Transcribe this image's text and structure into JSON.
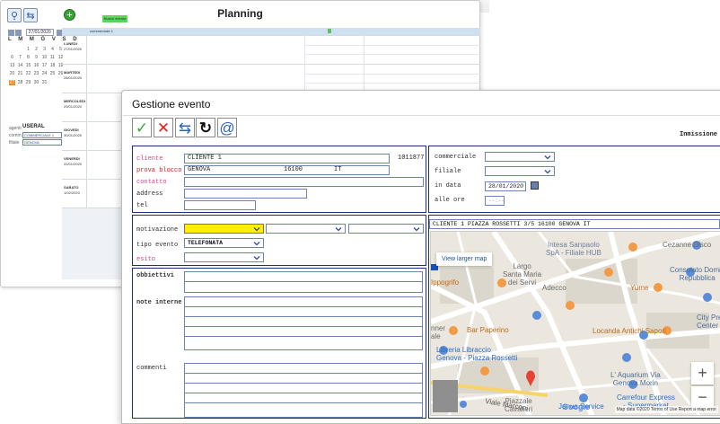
{
  "planning": {
    "title": "Planning",
    "badge": "Nuovo evento",
    "calendar": {
      "date": "27/01/2020",
      "weekday_header": "L M M G V S D",
      "weeks": [
        [
          "",
          "",
          "1",
          "2",
          "3",
          "4",
          "5"
        ],
        [
          "6",
          "7",
          "8",
          "9",
          "10",
          "11",
          "12"
        ],
        [
          "13",
          "14",
          "15",
          "16",
          "17",
          "18",
          "19"
        ],
        [
          "20",
          "21",
          "22",
          "23",
          "24",
          "25",
          "26"
        ],
        [
          "27",
          "28",
          "29",
          "30",
          "31",
          "",
          ""
        ]
      ],
      "today": "27"
    },
    "side": {
      "user_label": "agenti",
      "user_value": "USERAL",
      "select1_label": "comm.",
      "select1_value": "COMMERCIALE 1",
      "select2_label": "filiale",
      "select2_value": "GENOVA"
    },
    "grid_header": "commerciale 1",
    "days": [
      {
        "name": "LUNEDI",
        "date": "27/01/2020"
      },
      {
        "name": "MARTEDI",
        "date": "28/01/2020"
      },
      {
        "name": "MERCOLEDI",
        "date": "29/01/2020"
      },
      {
        "name": "GIOVEDI",
        "date": "30/01/2020"
      },
      {
        "name": "VENERDI",
        "date": "31/01/2020"
      },
      {
        "name": "SABATO",
        "date": "1/02/2020"
      }
    ]
  },
  "dialog": {
    "title": "Gestione evento",
    "immission_label": "Inmissione",
    "toolbar": {
      "confirm": "✓",
      "cancel": "✕",
      "sync": "⇆",
      "refresh": "↻",
      "email": "@"
    },
    "customer": {
      "cliente_label": "cliente",
      "cliente_value": "CLIENTE 1",
      "cliente_code": "1011877",
      "prova_label": "prova blocco",
      "prova_city": "GENOVA",
      "prova_zip": "16100",
      "prova_country": "IT",
      "contatto_label": "contatto",
      "contatto_value": "",
      "address_label": "address",
      "address_value": "",
      "tel_label": "tel",
      "tel_value": ""
    },
    "assignment": {
      "commerciale_label": "commerciale",
      "commerciale_value": "",
      "filiale_label": "filiale",
      "filiale_value": "",
      "data_label": "in data",
      "data_value": "28/01/2020",
      "ore_label": "alle ore",
      "ore_placeholder": "--:--"
    },
    "event": {
      "motivazione_label": "motivazione",
      "motivazione_value": "",
      "tipo_label": "tipo evento",
      "tipo_value": "TELEFONATA",
      "esito_label": "esito",
      "esito_value": ""
    },
    "notes": {
      "obiettivi_label": "obbiettivi",
      "note_label": "note interne",
      "commenti_label": "commenti"
    },
    "map": {
      "address": "CLIENTE 1   PIAZZA ROSSETTI 3/5  16100 GENOVA IT",
      "view_larger": "View larger map",
      "labels": {
        "intesa": "Intesa Sanpaolo\nSpA - Filiale HUB",
        "cezanne": "Cezanne Disco",
        "consolato": "Consolato Domin\nRepubblica",
        "largo": "Largo\nSanta Maria\ndei Servi",
        "ippogrifo": "Ippogrifo",
        "adecco": "Adecco",
        "yume": "Yume",
        "locanda": "Locanda Antichi Sapori",
        "citypre": "City Pre\nCenter I",
        "barpaperino": "Bar Paperino",
        "libreria": "Libreria Libraccio\nGenova - Piazza Rossetti",
        "aquarium": "L' Aquarium Via\nGenova Morin",
        "carrefour": "Carrefour Express\n- Supermarket",
        "janua": "Janua Service",
        "piazzale": "Piazzale\nCavalieri",
        "marconi": "Viale Marconi",
        "nner": "nner\nale"
      },
      "zoom_in": "+",
      "zoom_out": "−",
      "google": "Google",
      "footer": "Map data ©2020   Terms of Use   Report a map error"
    }
  },
  "colors": {
    "panel_border": "#1c2f85",
    "input_border": "#6d84b0",
    "yellow_select": "#fff000",
    "pink_label": "#e0408a",
    "red_label": "#e01a1a",
    "confirm_green": "#3aa53a",
    "cancel_red": "#e02020",
    "accent_blue": "#2a62c9"
  }
}
